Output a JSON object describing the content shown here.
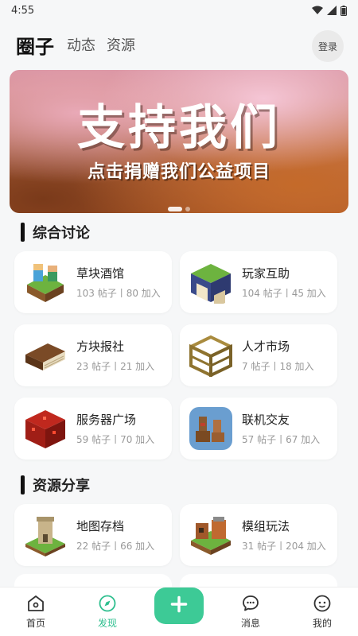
{
  "status": {
    "time": "4:55"
  },
  "header": {
    "tabs": [
      "圈子",
      "动态",
      "资源"
    ],
    "login": "登录"
  },
  "banner": {
    "title": "支持我们",
    "subtitle": "点击捐赠我们公益项目"
  },
  "sections": [
    {
      "title": "综合讨论",
      "items": [
        {
          "name": "草块酒馆",
          "stats": "103 帖子丨80 加入",
          "icon": "tavern-block-icon"
        },
        {
          "name": "玩家互助",
          "stats": "104 帖子丨45 加入",
          "icon": "book-block-icon"
        },
        {
          "name": "方块报社",
          "stats": "23 帖子丨21 加入",
          "icon": "brown-book-icon"
        },
        {
          "name": "人才市场",
          "stats": "7 帖子丨18 加入",
          "icon": "scaffold-block-icon"
        },
        {
          "name": "服务器广场",
          "stats": "59 帖子丨70 加入",
          "icon": "red-block-icon"
        },
        {
          "name": "联机交友",
          "stats": "57 帖子丨67 加入",
          "icon": "llama-friends-icon"
        }
      ]
    },
    {
      "title": "资源分享",
      "items": [
        {
          "name": "地图存档",
          "stats": "22 帖子丨66 加入",
          "icon": "map-tower-icon"
        },
        {
          "name": "模组玩法",
          "stats": "31 帖子丨204 加入",
          "icon": "mod-village-icon"
        }
      ]
    }
  ],
  "bottom_nav": [
    "首页",
    "发现",
    "消息",
    "我的"
  ],
  "colors": {
    "accent": "#3dca96",
    "active_tab": "#2fbf8f"
  }
}
